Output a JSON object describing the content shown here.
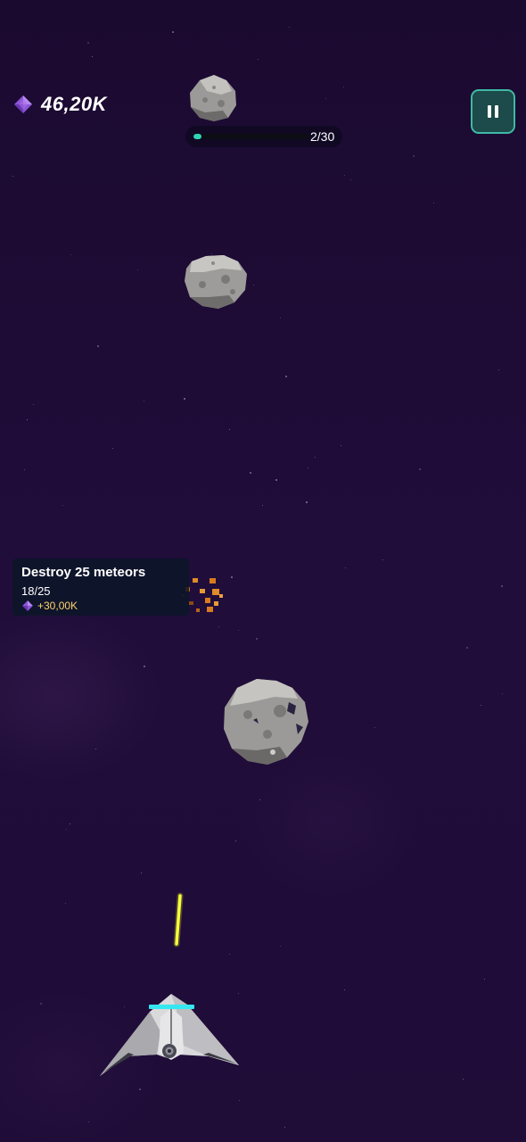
{
  "hud": {
    "currency_icon": "purple-gem-icon",
    "currency": "46,20K",
    "pause_icon": "pause-icon"
  },
  "wave": {
    "label": "2/30",
    "current": 2,
    "total": 30,
    "fill_fraction": 0.067,
    "fill_color": "#2fd6b5"
  },
  "mission": {
    "title": "Destroy 25 meteors",
    "progress": "18/25",
    "reward": "+30,00K",
    "reward_icon": "purple-gem-icon"
  },
  "colors": {
    "background": "#1e0b35",
    "accent": "#3fb9a6",
    "laser": "#ffff33",
    "reward_text": "#ffd36a"
  }
}
